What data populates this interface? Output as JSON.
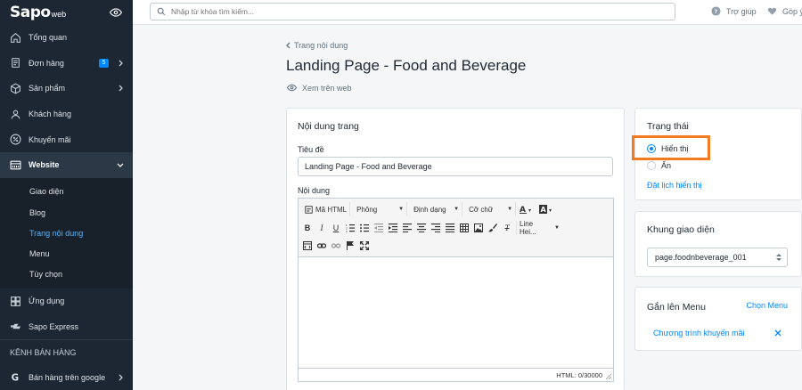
{
  "brand": {
    "logo": "Sapo",
    "logo_sub": "web"
  },
  "sidebar": {
    "items": [
      {
        "label": "Tổng quan",
        "icon": "home-icon"
      },
      {
        "label": "Đơn hàng",
        "icon": "order-icon",
        "badge": "5"
      },
      {
        "label": "Sản phẩm",
        "icon": "box-icon"
      },
      {
        "label": "Khách hàng",
        "icon": "user-icon"
      },
      {
        "label": "Khuyến mãi",
        "icon": "percent-icon"
      },
      {
        "label": "Website",
        "icon": "website-icon"
      }
    ],
    "website_sub": [
      "Giao diện",
      "Blog",
      "Trang nội dung",
      "Menu",
      "Tùy chọn"
    ],
    "items_after": [
      {
        "label": "Ứng dụng",
        "icon": "apps-icon"
      },
      {
        "label": "Sapo Express",
        "icon": "express-icon"
      }
    ],
    "section_label": "KÊNH BÁN HÀNG",
    "channel": {
      "label": "Bán hàng trên google",
      "icon": "google-icon"
    }
  },
  "topbar": {
    "search_placeholder": "Nhập từ khóa tìm kiếm...",
    "help_label": "Trợ giúp",
    "feedback_label": "Góp ý"
  },
  "page": {
    "breadcrumb": "Trang nội dung",
    "title": "Landing Page - Food and Beverage",
    "view_web": "Xem trên web"
  },
  "content_card": {
    "title": "Nội dung trang",
    "title_label": "Tiêu đề",
    "title_value": "Landing Page - Food and Beverage",
    "content_label": "Nội dung",
    "toolbar": {
      "html_label": "Mã HTML",
      "font_label": "Phông",
      "format_label": "Định dạng",
      "size_label": "Cỡ chữ",
      "line_height_label": "Line Hei..."
    },
    "status_text": "HTML: 0/30000"
  },
  "status_card": {
    "title": "Trạng thái",
    "option_show": "Hiển thị",
    "option_hide": "Ẩn",
    "selected": "Hiển thị",
    "schedule_link": "Đặt lịch hiển thị",
    "highlight_color": "#f47a20"
  },
  "theme_card": {
    "title": "Khung giao diện",
    "selected_value": "page.foodnbeverage_001"
  },
  "menu_card": {
    "title": "Gắn lên Menu",
    "choose_link": "Chọn Menu",
    "item": "Chương trình khuyến mãi"
  },
  "colors": {
    "sidebar_bg": "#1c2733",
    "accent": "#0088ff"
  }
}
